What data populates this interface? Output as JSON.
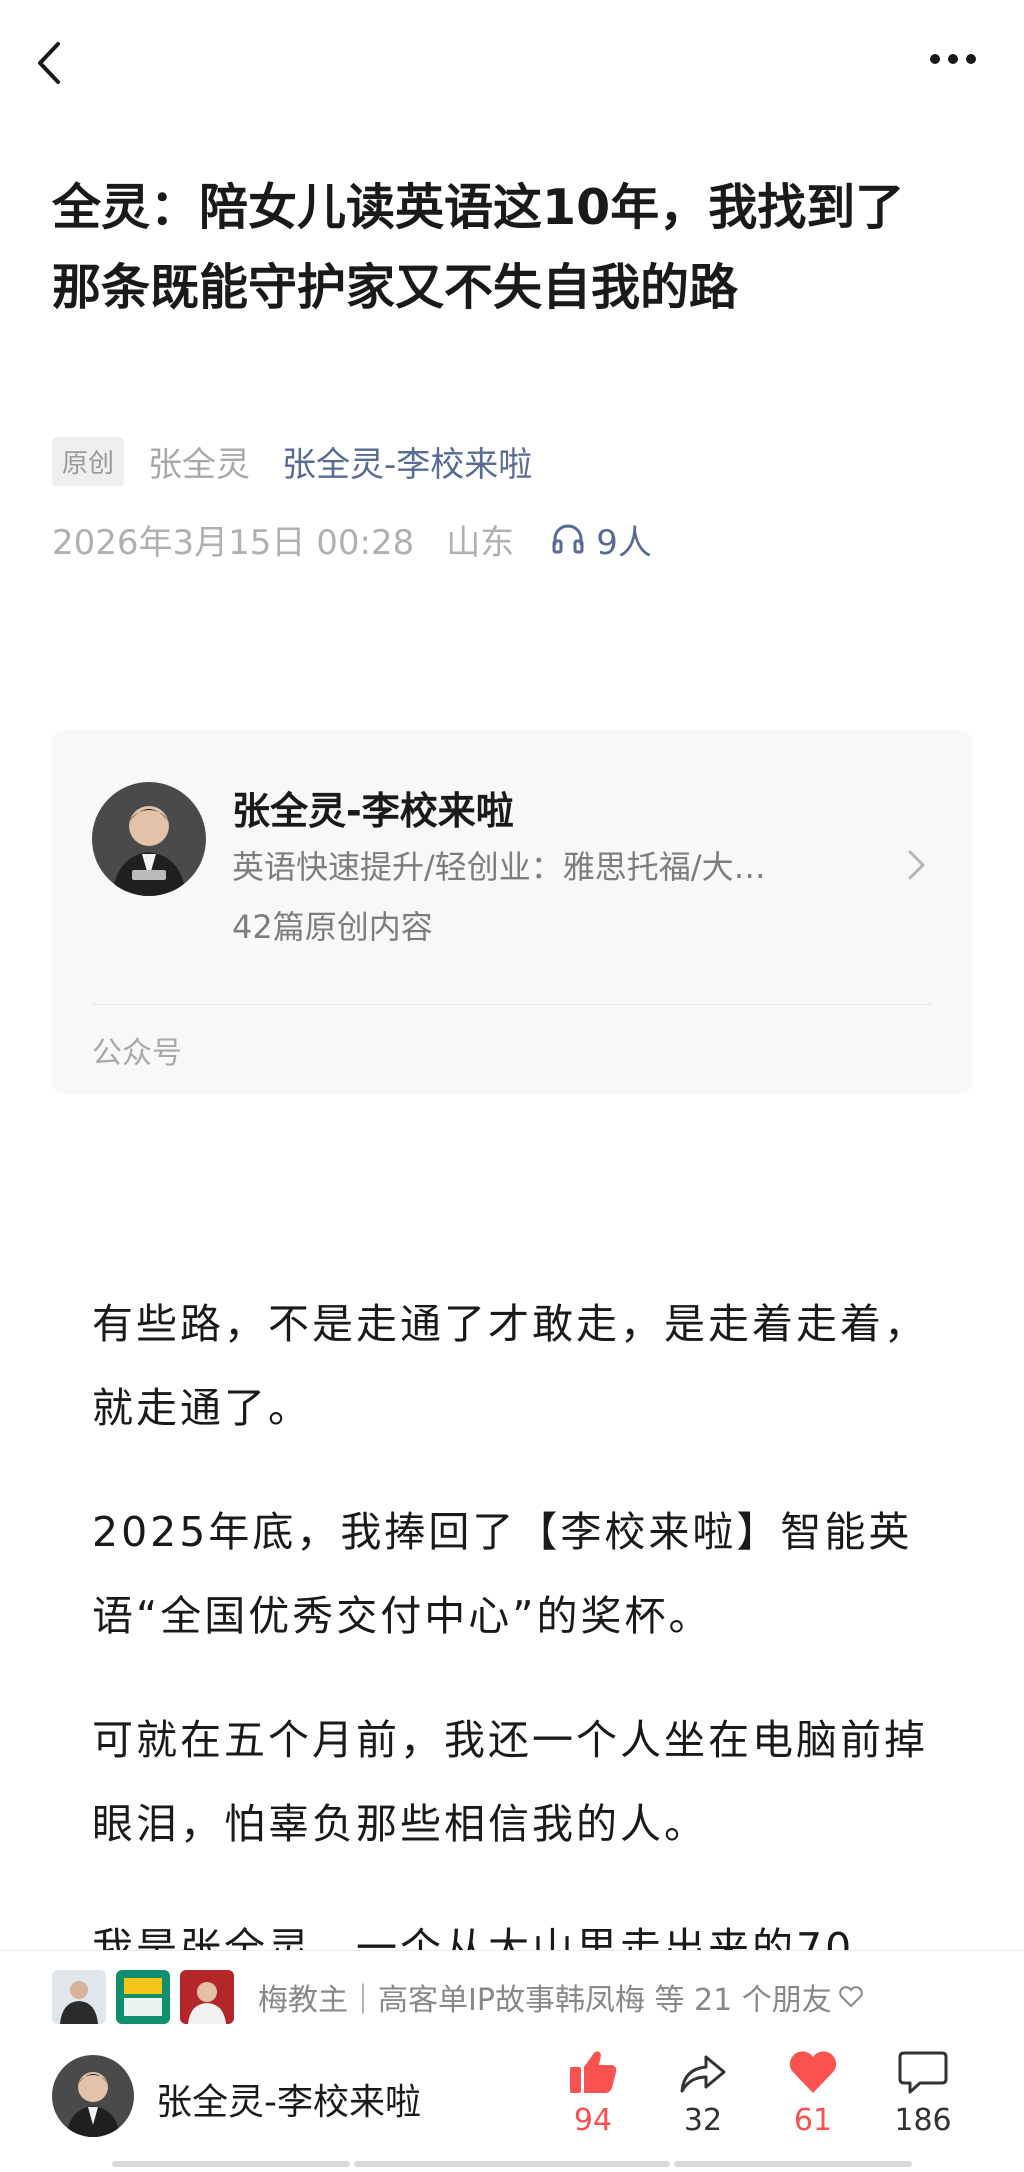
{
  "article": {
    "title": "全灵：陪女儿读英语这10年，我找到了那条既能守护家又不失自我的路",
    "original_tag": "原创",
    "author": "张全灵",
    "account_name": "张全灵-李校来啦",
    "date": "2026年3月15日 00:28",
    "region": "山东",
    "listen_count": "9人"
  },
  "account_card": {
    "name": "张全灵-李校来啦",
    "description": "英语快速提升/轻创业：雅思托福/大…",
    "article_count": "42篇原创内容",
    "type": "公众号"
  },
  "body": {
    "paragraphs": [
      "有些路，不是走通了才敢走，是走着走着，就走通了。",
      "2025年底，我捧回了【李校来啦】智能英语“全国优秀交付中心”的奖杯。",
      "可就在五个月前，我还一个人坐在电脑前掉眼泪，怕辜负那些相信我的人。",
      "我是张全灵，一个从大山里走出来的70"
    ]
  },
  "bottom_bar": {
    "friends_text": "梅教主｜高客单IP故事韩凤梅 等 21 个朋友",
    "account_name": "张全灵-李校来啦",
    "like_count": "94",
    "share_count": "32",
    "heart_count": "61",
    "comment_count": "186"
  },
  "colors": {
    "link": "#576b95",
    "accent_red": "#fa5151",
    "muted": "#a8a8a8"
  }
}
